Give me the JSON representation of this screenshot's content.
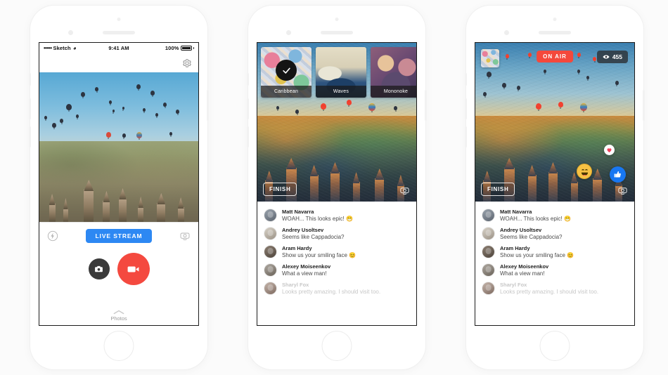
{
  "background_color": "#fbfbfb",
  "status_bar": {
    "signal_dots": "•••••",
    "carrier": "Sketch",
    "wifi_icon": "wifi-icon",
    "time": "9:41 AM",
    "battery_percent": "100%",
    "battery_icon": "battery-full-icon"
  },
  "phone1": {
    "nav": {
      "settings_icon": "gear-icon"
    },
    "photo": {
      "alt": "Cappadocia hot air balloons at sunrise",
      "balloon_count": 24
    },
    "controls": {
      "flash_icon": "flash-icon",
      "live_stream_label": "LIVE STREAM",
      "live_stream_color": "#2d88f3",
      "flip_camera_icon": "flip-camera-icon",
      "photo_button_icon": "camera-icon",
      "video_button_icon": "video-camera-icon",
      "video_button_color": "#f4493f",
      "photo_button_color": "#3a3a3a",
      "chevron_icon": "chevron-up-icon",
      "photos_label": "Photos"
    }
  },
  "phone2": {
    "filters": [
      {
        "name": "Caribbean",
        "selected": true,
        "check_icon": "check-icon",
        "thumb": "caribbean-thumb"
      },
      {
        "name": "Waves",
        "selected": false,
        "thumb": "waves-thumb"
      },
      {
        "name": "Mononoke",
        "selected": false,
        "thumb": "mononoke-thumb"
      }
    ],
    "overlay": {
      "finish_label": "FINISH",
      "flip_camera_icon": "flip-camera-icon"
    }
  },
  "phone3": {
    "overlay": {
      "on_air_label": "ON AIR",
      "on_air_color": "#f4483c",
      "viewers_icon": "eye-icon",
      "viewers_count": "455",
      "mini_filter_thumb": "caribbean-thumb",
      "finish_label": "FINISH",
      "flip_camera_icon": "flip-camera-icon"
    },
    "reactions": [
      {
        "name": "heart-reaction",
        "icon": "heart-icon",
        "color": "#f2415a"
      },
      {
        "name": "laugh-reaction",
        "icon": "laughing-face-icon",
        "color": "#f7c244"
      },
      {
        "name": "like-reaction",
        "icon": "thumbs-up-icon",
        "color": "#1877f2"
      }
    ]
  },
  "comments": [
    {
      "name": "Matt Navarra",
      "text": "WOAH... This looks epic! 😁",
      "faded": false
    },
    {
      "name": "Andrey Usoltsev",
      "text": "Seems like Cappadocia?",
      "faded": false
    },
    {
      "name": "Aram Hardy",
      "text": "Show us your smiling face 😊",
      "faded": false
    },
    {
      "name": "Alexey Moiseenkov",
      "text": "What a view man!",
      "faded": false
    },
    {
      "name": "Sharyl Fox",
      "text": "Looks pretty amazing. I should visit too.",
      "faded": true
    }
  ]
}
